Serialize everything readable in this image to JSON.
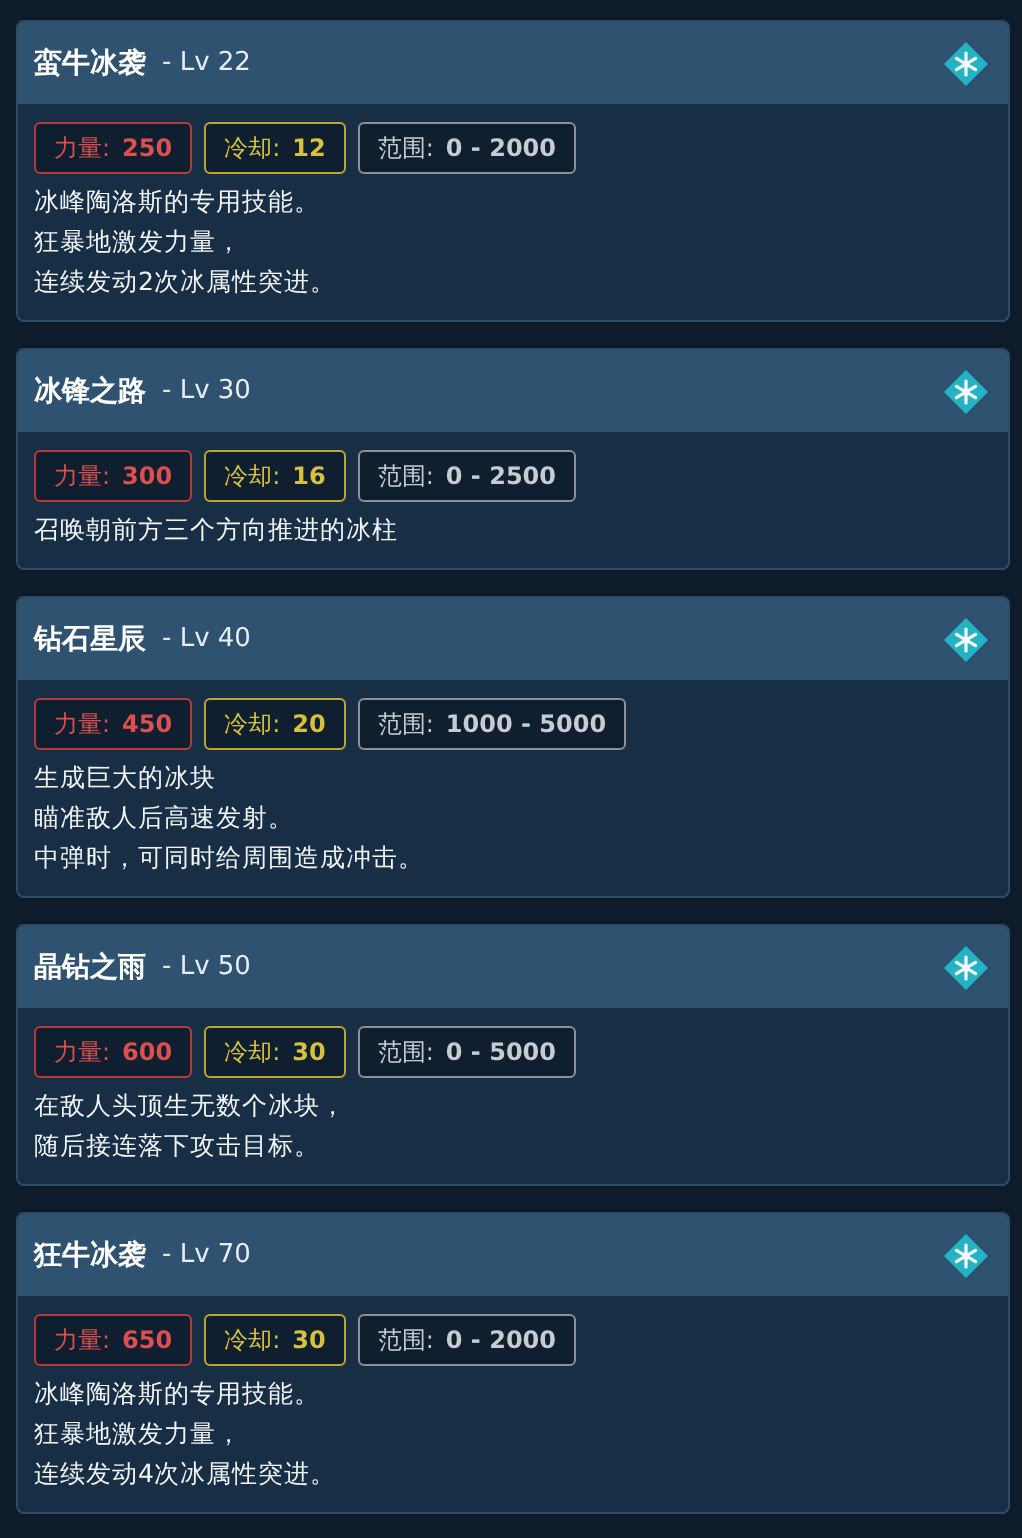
{
  "skills": [
    {
      "name": "蛮牛冰袭",
      "level": "- Lv 22",
      "stats": [
        {
          "kind": "power",
          "label": "力量:",
          "value": "250"
        },
        {
          "kind": "cooldown",
          "label": "冷却:",
          "value": "12"
        },
        {
          "kind": "range",
          "label": "范围:",
          "value": "0 - 2000"
        }
      ],
      "description": [
        "冰峰陶洛斯的专用技能。",
        "狂暴地激发力量，",
        "连续发动2次冰属性突进。"
      ]
    },
    {
      "name": "冰锋之路",
      "level": "- Lv 30",
      "stats": [
        {
          "kind": "power",
          "label": "力量:",
          "value": "300"
        },
        {
          "kind": "cooldown",
          "label": "冷却:",
          "value": "16"
        },
        {
          "kind": "range",
          "label": "范围:",
          "value": "0 - 2500"
        }
      ],
      "description": [
        "召唤朝前方三个方向推进的冰柱"
      ]
    },
    {
      "name": "钻石星辰",
      "level": "- Lv 40",
      "stats": [
        {
          "kind": "power",
          "label": "力量:",
          "value": "450"
        },
        {
          "kind": "cooldown",
          "label": "冷却:",
          "value": "20"
        },
        {
          "kind": "range",
          "label": "范围:",
          "value": "1000 - 5000"
        }
      ],
      "description": [
        "生成巨大的冰块",
        "瞄准敌人后高速发射。",
        "中弹时，可同时给周围造成冲击。"
      ]
    },
    {
      "name": "晶钻之雨",
      "level": "- Lv 50",
      "stats": [
        {
          "kind": "power",
          "label": "力量:",
          "value": "600"
        },
        {
          "kind": "cooldown",
          "label": "冷却:",
          "value": "30"
        },
        {
          "kind": "range",
          "label": "范围:",
          "value": "0 - 5000"
        }
      ],
      "description": [
        "在敌人头顶生无数个冰块，",
        "随后接连落下攻击目标。"
      ]
    },
    {
      "name": "狂牛冰袭",
      "level": "- Lv 70",
      "stats": [
        {
          "kind": "power",
          "label": "力量:",
          "value": "650"
        },
        {
          "kind": "cooldown",
          "label": "冷却:",
          "value": "30"
        },
        {
          "kind": "range",
          "label": "范围:",
          "value": "0 - 2000"
        }
      ],
      "description": [
        "冰峰陶洛斯的专用技能。",
        "狂暴地激发力量，",
        "连续发动4次冰属性突进。"
      ]
    }
  ]
}
